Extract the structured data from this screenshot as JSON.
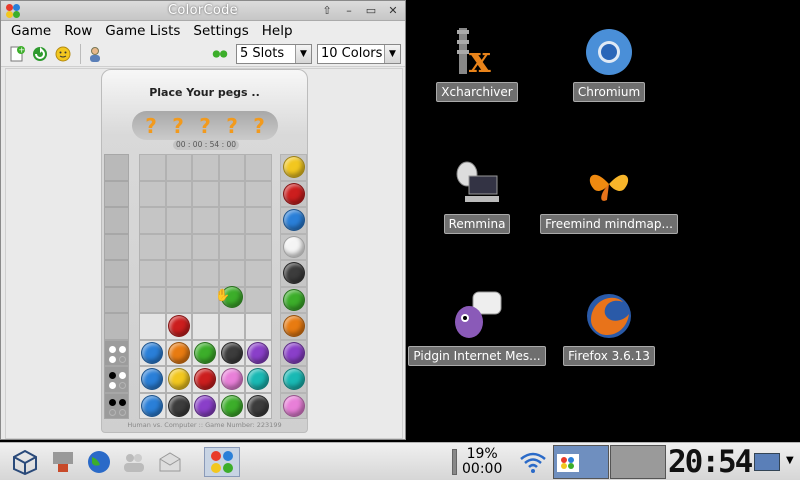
{
  "window": {
    "title": "ColorCode",
    "menu": [
      "Game",
      "Row",
      "Game Lists",
      "Settings",
      "Help"
    ],
    "slots_select": "5 Slots",
    "colors_select": "10 Colors"
  },
  "board": {
    "message": "Place Your pegs ..",
    "secret": [
      "?",
      "?",
      "?",
      "?",
      "?"
    ],
    "timer": "00 : 00 : 54 : 00",
    "footer": "Human vs. Computer :: Game Number: 223199"
  },
  "colors": {
    "yellow": "#f2c71f",
    "red": "#cc1e1e",
    "blue": "#2a7fd8",
    "white": "#f4f4f4",
    "dark": "#3c3c3c",
    "green": "#3cae2a",
    "orange": "#e87b11",
    "purple": "#8a3fc9",
    "teal": "#19b9b4",
    "pink": "#e87fd8"
  },
  "palette": [
    "yellow",
    "red",
    "blue",
    "white",
    "dark",
    "green",
    "orange",
    "purple",
    "teal",
    "pink"
  ],
  "rows": [
    {
      "pegs": [
        null,
        null,
        null,
        null,
        null
      ],
      "hints": []
    },
    {
      "pegs": [
        null,
        null,
        null,
        null,
        null
      ],
      "hints": []
    },
    {
      "pegs": [
        null,
        null,
        null,
        null,
        null
      ],
      "hints": []
    },
    {
      "pegs": [
        null,
        null,
        null,
        null,
        null
      ],
      "hints": []
    },
    {
      "pegs": [
        null,
        null,
        null,
        null,
        null
      ],
      "hints": []
    },
    {
      "pegs": [
        null,
        null,
        null,
        null,
        null
      ],
      "hints": []
    },
    {
      "pegs": [
        null,
        "red",
        null,
        null,
        null
      ],
      "hints": [],
      "active": true
    },
    {
      "pegs": [
        "blue",
        "orange",
        "green",
        "dark",
        "purple"
      ],
      "hints": [
        "white",
        "white",
        "white",
        "empty"
      ]
    },
    {
      "pegs": [
        "blue",
        "yellow",
        "red",
        "pink",
        "teal"
      ],
      "hints": [
        "black",
        "white",
        "white",
        "empty"
      ]
    },
    {
      "pegs": [
        "blue",
        "dark",
        "purple",
        "green",
        "dark"
      ],
      "hints": [
        "black",
        "black",
        "empty",
        "empty"
      ]
    }
  ],
  "desktop": [
    {
      "label": "Xcharchiver",
      "icon": "xarchiver-icon"
    },
    {
      "label": "Chromium",
      "icon": "chromium-icon"
    },
    {
      "label": "Remmina",
      "icon": "remmina-icon"
    },
    {
      "label": "Freemind mindmap...",
      "icon": "freemind-icon"
    },
    {
      "label": "Pidgin Internet Mes...",
      "icon": "pidgin-icon"
    },
    {
      "label": "Firefox 3.6.13",
      "icon": "firefox-icon"
    }
  ],
  "taskbar": {
    "battery_percent": "19%",
    "battery_time": "00:00",
    "clock": "20:54"
  }
}
